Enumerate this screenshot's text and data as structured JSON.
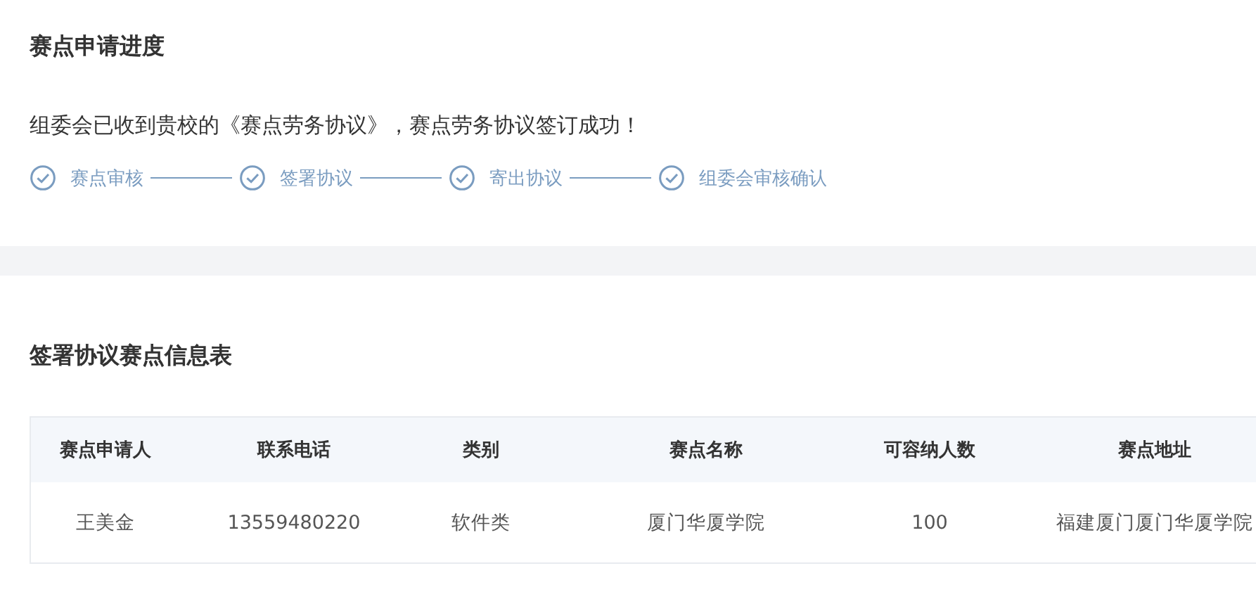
{
  "progress": {
    "title": "赛点申请进度",
    "message": "组委会已收到贵校的《赛点劳务协议》，赛点劳务协议签订成功！",
    "steps": [
      {
        "label": "赛点审核",
        "done": true
      },
      {
        "label": "签署协议",
        "done": true
      },
      {
        "label": "寄出协议",
        "done": true
      },
      {
        "label": "组委会审核确认",
        "done": true
      }
    ]
  },
  "info": {
    "title": "签署协议赛点信息表",
    "table": {
      "columns": [
        "赛点申请人",
        "联系电话",
        "类别",
        "赛点名称",
        "可容纳人数",
        "赛点地址"
      ],
      "rows": [
        [
          "王美金",
          "13559480220",
          "软件类",
          "厦门华厦学院",
          "100",
          "福建厦门厦门华厦学院"
        ]
      ]
    }
  }
}
